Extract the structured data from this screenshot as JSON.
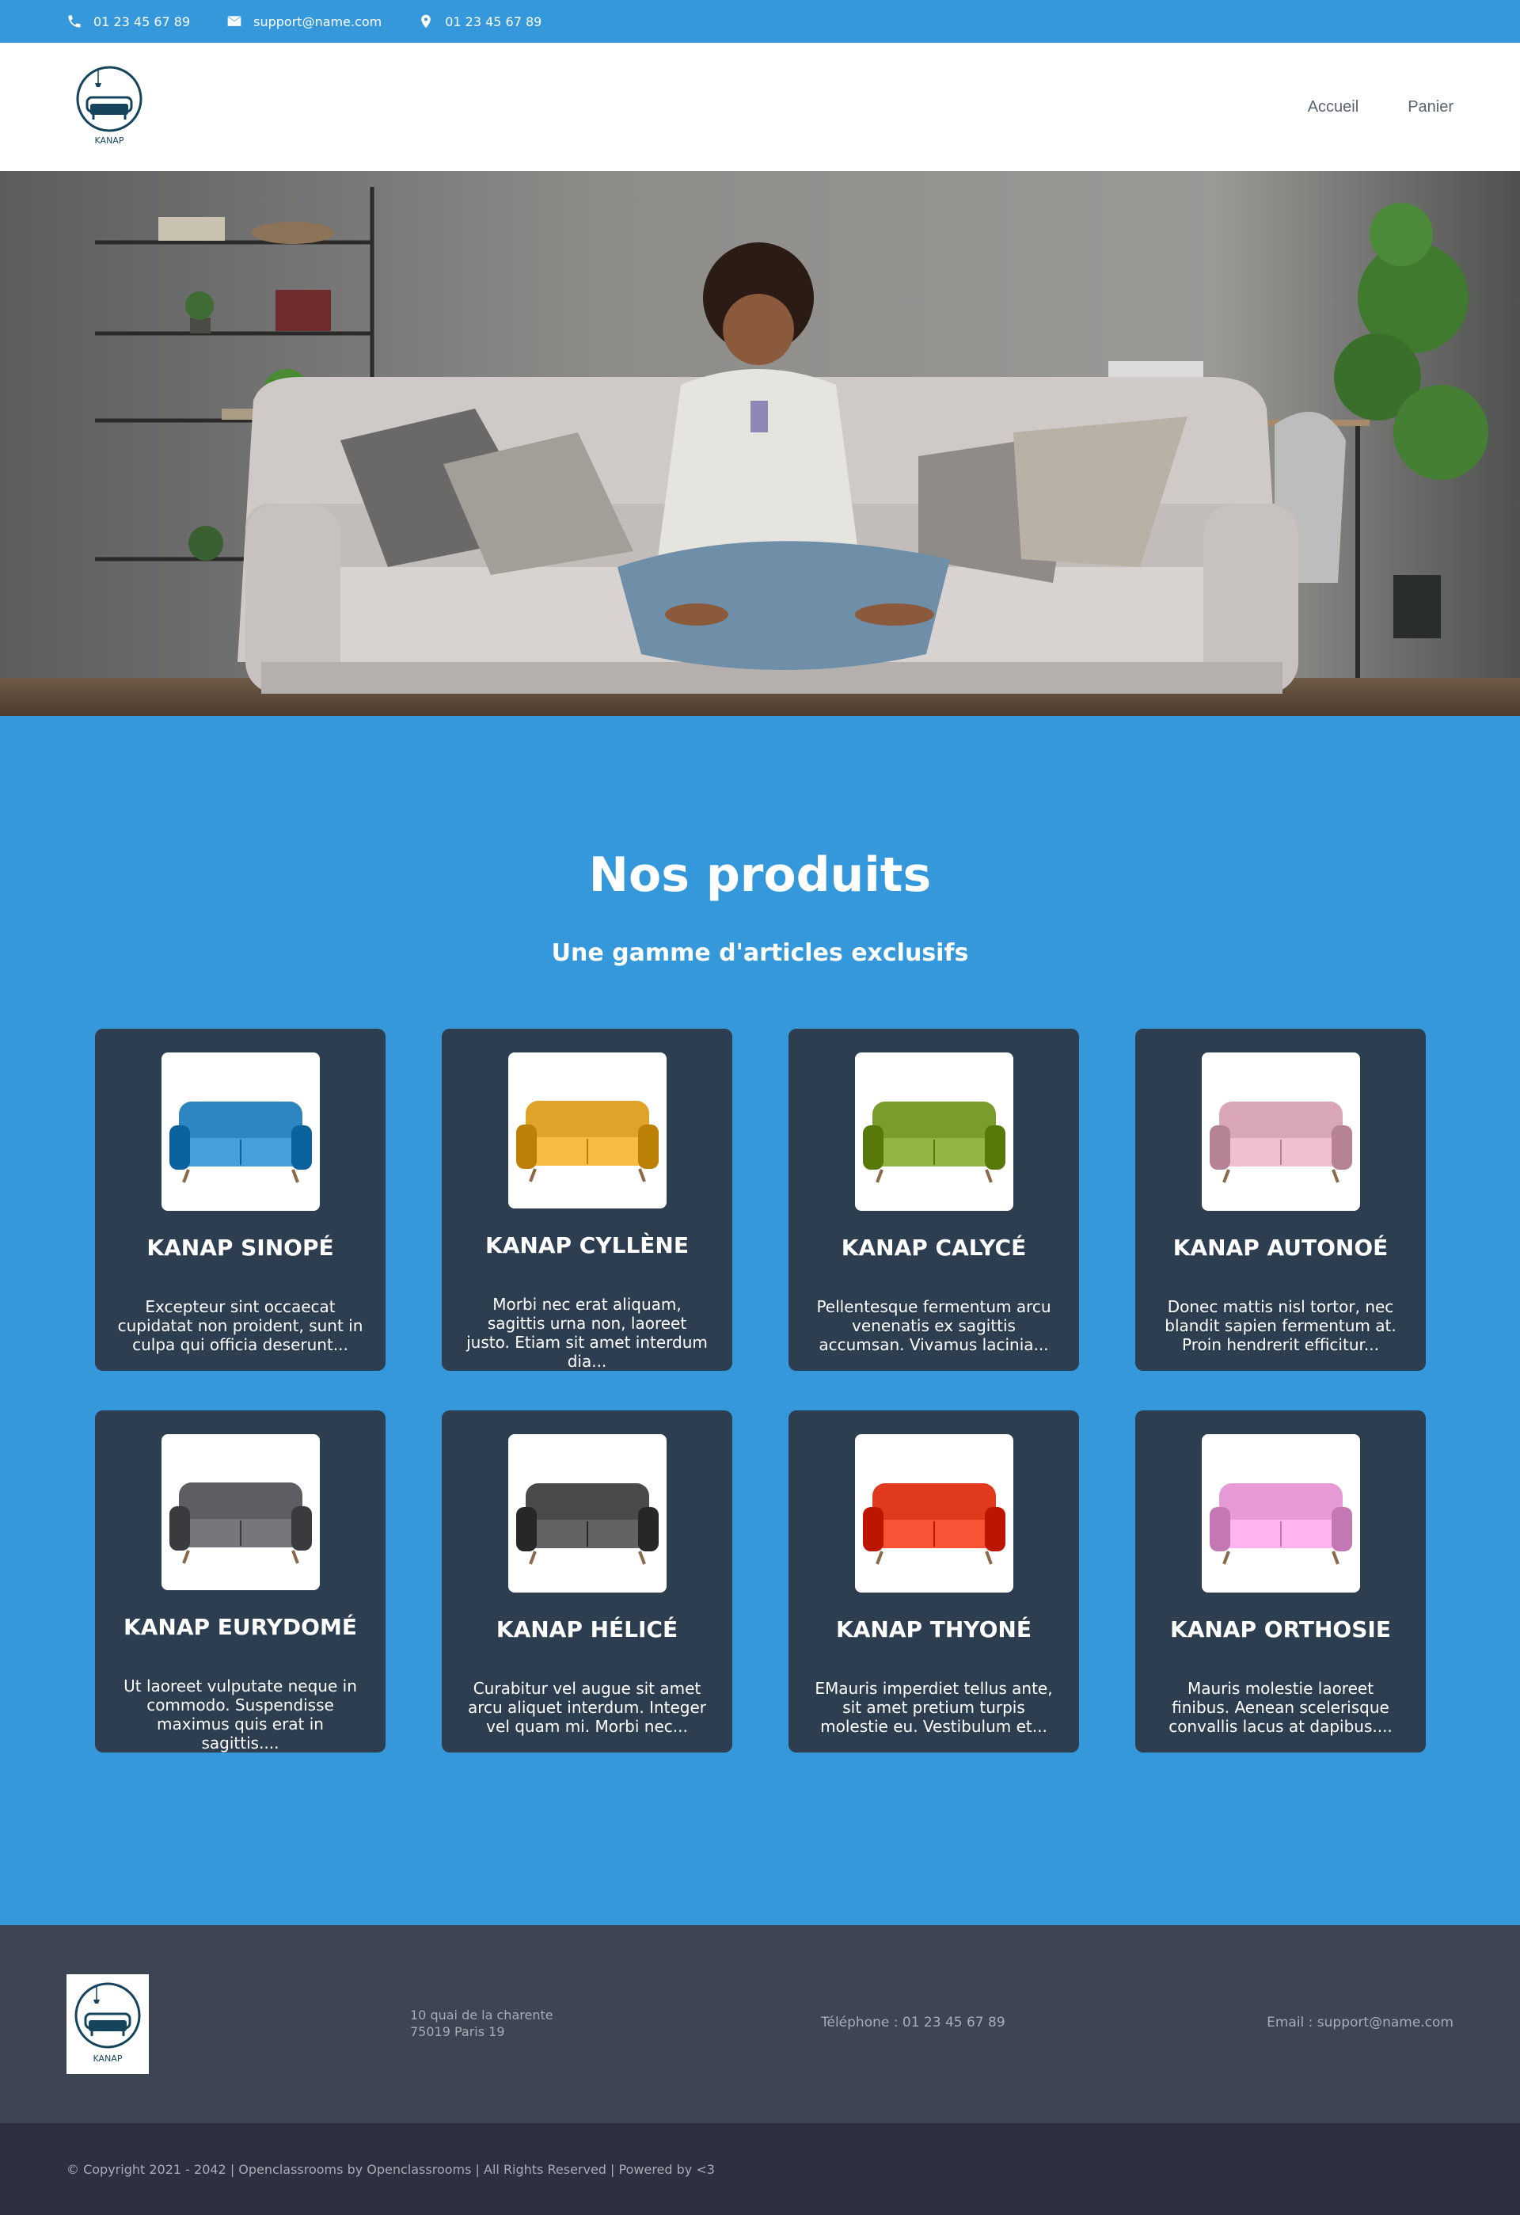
{
  "topbar": {
    "phone": "01 23 45 67 89",
    "email": "support@name.com",
    "location": "01 23 45 67 89"
  },
  "header": {
    "logo_text": "KANAP",
    "nav": [
      {
        "label": "Accueil"
      },
      {
        "label": "Panier"
      }
    ]
  },
  "products": {
    "title": "Nos produits",
    "subtitle": "Une gamme d'articles exclusifs",
    "items": [
      {
        "name": "KANAP SINOPÉ",
        "description": "Excepteur sint occaecat cupidatat non proident, sunt in culpa qui officia deserunt...",
        "color": "#2e86c1"
      },
      {
        "name": "KANAP CYLLÈNE",
        "description": "Morbi nec erat aliquam, sagittis urna non, laoreet justo. Etiam sit amet interdum dia...",
        "color": "#e0a32a"
      },
      {
        "name": "KANAP CALYCÉ",
        "description": "Pellentesque fermentum arcu venenatis ex sagittis accumsan. Vivamus lacinia...",
        "color": "#7a9c2c"
      },
      {
        "name": "KANAP AUTONOÉ",
        "description": "Donec mattis nisl tortor, nec blandit sapien fermentum at. Proin hendrerit efficitur...",
        "color": "#d9a6b8"
      },
      {
        "name": "KANAP EURYDOMÉ",
        "description": "Ut laoreet vulputate neque in commodo. Suspendisse maximus quis erat in sagittis....",
        "color": "#5e5e62"
      },
      {
        "name": "KANAP HÉLICÉ",
        "description": "Curabitur vel augue sit amet arcu aliquet interdum. Integer vel quam mi. Morbi nec...",
        "color": "#4b4a4a"
      },
      {
        "name": "KANAP THYONÉ",
        "description": "EMauris imperdiet tellus ante, sit amet pretium turpis molestie eu. Vestibulum et...",
        "color": "#e0391c"
      },
      {
        "name": "KANAP ORTHOSIE",
        "description": "Mauris molestie laoreet finibus. Aenean scelerisque convallis lacus at dapibus....",
        "color": "#e79bd6"
      }
    ]
  },
  "footer": {
    "logo_text": "KANAP",
    "address_line1": "10 quai de la charente",
    "address_line2": "75019 Paris 19",
    "phone": "Téléphone : 01 23 45 67 89",
    "email": "Email : support@name.com",
    "copyright": "© Copyright 2021 - 2042 | Openclassrooms by Openclassrooms | All Rights Reserved | Powered by <3"
  },
  "colors": {
    "brand_blue": "#3498db",
    "card_bg": "#2c3e50",
    "footer_bg": "#3d4452",
    "copyright_bg": "#2e2f3f"
  }
}
